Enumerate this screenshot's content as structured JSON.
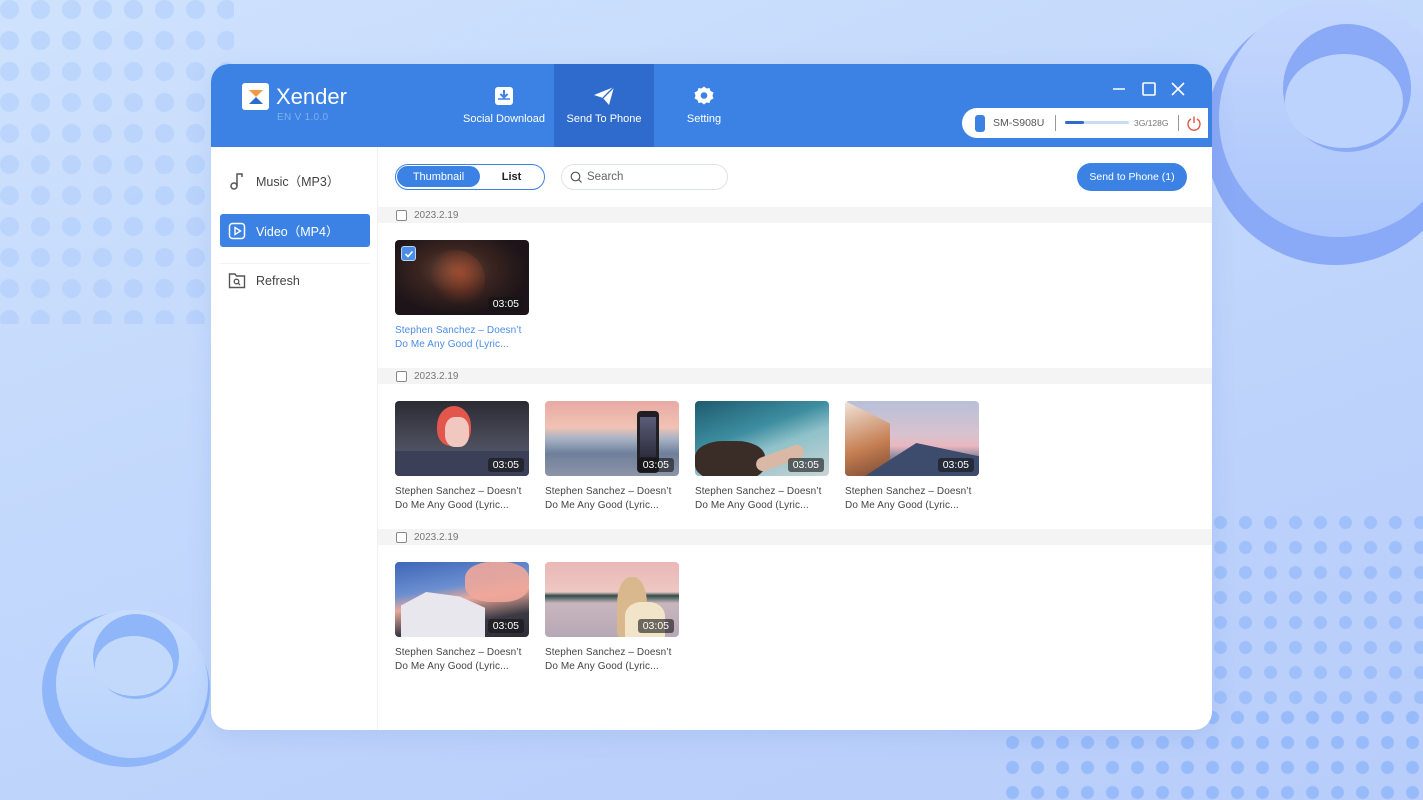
{
  "app": {
    "name": "Xender",
    "version": "EN  V 1.0.0",
    "brand_color": "#3c82e4",
    "active_color": "#2f6bcc"
  },
  "nav_tabs": [
    {
      "label": "Social Download",
      "icon": "download-tray-icon",
      "active": false
    },
    {
      "label": "Send To Phone",
      "icon": "paper-plane-icon",
      "active": true
    },
    {
      "label": "Setting",
      "icon": "gear-icon",
      "active": false
    }
  ],
  "window_controls": [
    "minimize",
    "maximize",
    "close"
  ],
  "device": {
    "name": "SM-S908U",
    "storage_text": "3G/128G",
    "storage_used_fraction": 0.3,
    "power_color": "#e05545"
  },
  "sidebar": {
    "items": [
      {
        "label": "Music（MP3）",
        "icon": "music-note-icon",
        "active": false
      },
      {
        "label": "Video（MP4）",
        "icon": "video-play-icon",
        "active": true
      },
      {
        "label": "Refresh",
        "icon": "folder-search-icon",
        "active": false
      }
    ]
  },
  "toolbar": {
    "view_options": [
      "Thumbnail",
      "List"
    ],
    "active_view": "Thumbnail",
    "search_placeholder": "Search",
    "search_value": "",
    "send_button_label": "Send to Phone  (1)"
  },
  "groups": [
    {
      "date": "2023.2.19",
      "checked": false,
      "videos": [
        {
          "title_line1": "Stephen Sanchez – Doesn’t",
          "title_line2": "Do Me Any Good (Lyric...",
          "duration": "03:05",
          "selected": true,
          "scene": "fire-portrait"
        }
      ]
    },
    {
      "date": "2023.2.19",
      "checked": false,
      "videos": [
        {
          "title_line1": "Stephen Sanchez – Doesn’t",
          "title_line2": "Do Me Any Good (Lyric...",
          "duration": "03:05",
          "selected": false,
          "scene": "car-window"
        },
        {
          "title_line1": "Stephen Sanchez – Doesn’t",
          "title_line2": "Do Me Any Good (Lyric...",
          "duration": "03:05",
          "selected": false,
          "scene": "sunset-phone"
        },
        {
          "title_line1": "Stephen Sanchez – Doesn’t",
          "title_line2": "Do Me Any Good (Lyric...",
          "duration": "03:05",
          "selected": false,
          "scene": "boat-wake"
        },
        {
          "title_line1": "Stephen Sanchez – Doesn’t",
          "title_line2": "Do Me Any Good (Lyric...",
          "duration": "03:05",
          "selected": false,
          "scene": "rooftop-dusk"
        }
      ]
    },
    {
      "date": "2023.2.19",
      "checked": false,
      "videos": [
        {
          "title_line1": "Stephen Sanchez – Doesn’t",
          "title_line2": "Do Me Any Good (Lyric...",
          "duration": "03:05",
          "selected": false,
          "scene": "house-pink-sky"
        },
        {
          "title_line1": "Stephen Sanchez – Doesn’t",
          "title_line2": "Do Me Any Good (Lyric...",
          "duration": "03:05",
          "selected": false,
          "scene": "girl-shore"
        }
      ]
    }
  ]
}
